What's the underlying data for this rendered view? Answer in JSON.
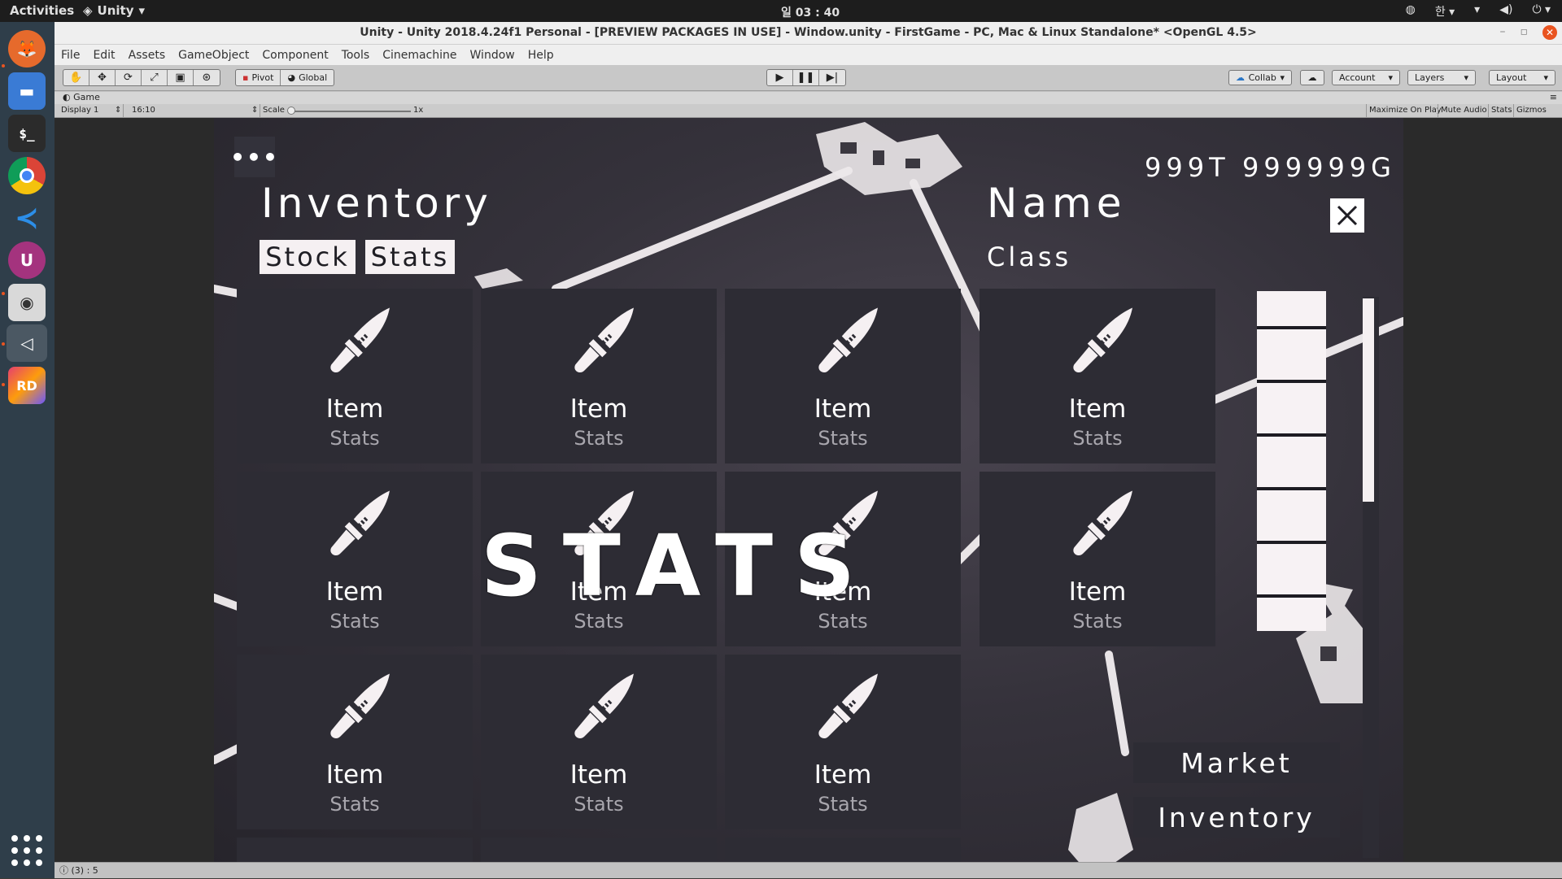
{
  "topbar": {
    "activities": "Activities",
    "app_name": "Unity",
    "clock": "일 03 : 40"
  },
  "window": {
    "title": "Unity - Unity 2018.4.24f1 Personal - [PREVIEW PACKAGES IN USE] - Window.unity - FirstGame - PC, Mac & Linux Standalone* <OpenGL 4.5>"
  },
  "menu": [
    "File",
    "Edit",
    "Assets",
    "GameObject",
    "Component",
    "Tools",
    "Cinemachine",
    "Window",
    "Help"
  ],
  "toolbar": {
    "pivot": "Pivot",
    "global": "Global",
    "collab": "Collab",
    "account": "Account",
    "layers": "Layers",
    "layout": "Layout"
  },
  "game_tab": {
    "label": "Game",
    "display": "Display 1",
    "aspect": "16:10",
    "scale_label": "Scale",
    "scale_value": "1x",
    "maximize": "Maximize On Play",
    "mute": "Mute Audio",
    "stats": "Stats",
    "gizmos": "Gizmos"
  },
  "game": {
    "menu_dots": "•••",
    "inventory_title": "Inventory",
    "tab_stock": "Stock",
    "tab_stats": "Stats",
    "tokens": "999T",
    "gold": "999999G",
    "name": "Name",
    "class": "Class",
    "overlay_text": "STATS",
    "items": [
      {
        "name": "Item",
        "stats": "Stats"
      },
      {
        "name": "Item",
        "stats": "Stats"
      },
      {
        "name": "Item",
        "stats": "Stats"
      },
      {
        "name": "Item",
        "stats": "Stats"
      },
      {
        "name": "Item",
        "stats": "Stats"
      },
      {
        "name": "Item",
        "stats": "Stats"
      },
      {
        "name": "Item",
        "stats": "Stats"
      },
      {
        "name": "Item",
        "stats": "Stats"
      },
      {
        "name": "Item",
        "stats": "Stats"
      },
      {
        "name": "Item",
        "stats": "Stats"
      },
      {
        "name": "Item",
        "stats": "Stats"
      }
    ],
    "side_market": "Market",
    "side_inventory": "Inventory"
  },
  "status_bar": {
    "text": "(3) : 5"
  }
}
